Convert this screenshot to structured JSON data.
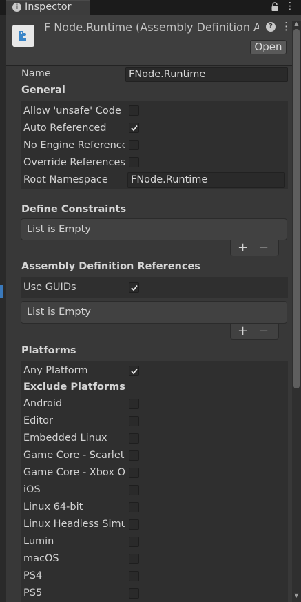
{
  "tab": {
    "title": "Inspector",
    "info_icon": "info-icon",
    "lock_icon": "lock-icon",
    "menu_icon": "kebab-menu-icon"
  },
  "header": {
    "title": "F Node.Runtime (Assembly Definition As",
    "help_icon": "help-icon",
    "menu_icon": "kebab-menu-icon",
    "open_label": "Open"
  },
  "name": {
    "label": "Name",
    "value": "FNode.Runtime"
  },
  "general": {
    "heading": "General",
    "allow_unsafe": {
      "label": "Allow 'unsafe' Code",
      "checked": false
    },
    "auto_referenced": {
      "label": "Auto Referenced",
      "checked": true
    },
    "no_engine_refs": {
      "label": "No Engine References",
      "checked": false
    },
    "override_refs": {
      "label": "Override References",
      "checked": false
    },
    "root_namespace": {
      "label": "Root Namespace",
      "value": "FNode.Runtime"
    }
  },
  "define_constraints": {
    "heading": "Define Constraints",
    "empty_text": "List is Empty",
    "add": "+",
    "remove": "−"
  },
  "asm_refs": {
    "heading": "Assembly Definition References",
    "use_guids": {
      "label": "Use GUIDs",
      "checked": true
    },
    "empty_text": "List is Empty",
    "add": "+",
    "remove": "−"
  },
  "platforms": {
    "heading": "Platforms",
    "any_platform": {
      "label": "Any Platform",
      "checked": true
    },
    "exclude_heading": "Exclude Platforms",
    "items": [
      {
        "label": "Android",
        "checked": false
      },
      {
        "label": "Editor",
        "checked": false
      },
      {
        "label": "Embedded Linux",
        "checked": false
      },
      {
        "label": "Game Core - Scarlett",
        "checked": false
      },
      {
        "label": "Game Core - Xbox One",
        "checked": false
      },
      {
        "label": "iOS",
        "checked": false
      },
      {
        "label": "Linux 64-bit",
        "checked": false
      },
      {
        "label": "Linux Headless Simulation",
        "checked": false
      },
      {
        "label": "Lumin",
        "checked": false
      },
      {
        "label": "macOS",
        "checked": false
      },
      {
        "label": "PS4",
        "checked": false
      },
      {
        "label": "PS5",
        "checked": false
      }
    ]
  },
  "colors": {
    "panel": "#383838",
    "field": "#2a2a2a",
    "accent": "#3a79bb"
  }
}
